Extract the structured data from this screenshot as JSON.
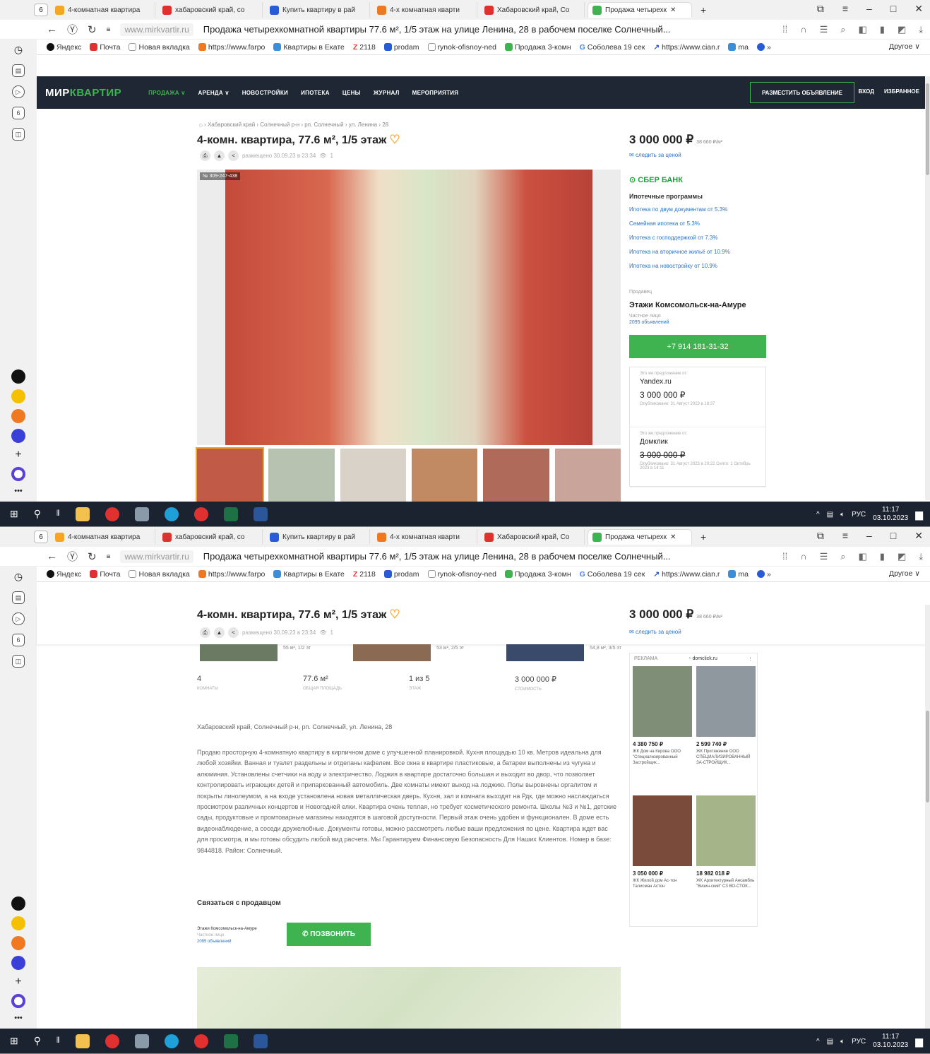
{
  "browser": {
    "tab_count": "6",
    "tabs": [
      {
        "label": "4-комнатная квартира",
        "color": "#f5a623"
      },
      {
        "label": "хабаровский край, со",
        "color": "#e03030"
      },
      {
        "label": "Купить квартиру в рай",
        "color": "#2a5bd7"
      },
      {
        "label": "4-х комнатная кварти",
        "color": "#f07820"
      },
      {
        "label": "Хабаровский край, Со",
        "color": "#e03030"
      },
      {
        "label": "Продажа четырехк",
        "color": "#3eb34f",
        "active": true
      }
    ],
    "new_tab": "+",
    "url": "www.mirkvartir.ru",
    "page_title": "Продажа четырехкомнатной квартиры 77.6 м², 1/5 этаж на улице Ленина, 28 в рабочем поселке Солнечный...",
    "bookmarks": [
      {
        "label": "Яндекс",
        "color": "#111"
      },
      {
        "label": "Почта",
        "color": "#e03030"
      },
      {
        "label": "Новая вкладка",
        "color": "#bbb"
      },
      {
        "label": "https://www.farpo",
        "color": "#f07820"
      },
      {
        "label": "Квартиры в Екате",
        "color": "#3a8fd8"
      },
      {
        "label": "2118",
        "color": "#e03030"
      },
      {
        "label": "prodam",
        "color": "#2a5bd7"
      },
      {
        "label": "rynok-ofisnoy-ned",
        "color": "#bbb"
      },
      {
        "label": "Продажа 3-комн",
        "color": "#3eb34f"
      },
      {
        "label": "Соболева 19 сек",
        "color": "#4285f4"
      },
      {
        "label": "https://www.cian.r",
        "color": "#2a5bd7"
      },
      {
        "label": "ma",
        "color": "#3a8fd8"
      },
      {
        "label": "»",
        "color": "#fff"
      }
    ],
    "bookmarks_other": "Другое ∨"
  },
  "taskbar": {
    "lang": "РУС",
    "time": "11:17",
    "date": "03.10.2023"
  },
  "site": {
    "logo_a": "МИР",
    "logo_b": "КВАРТИР",
    "menu": [
      "ПРОДАЖА ∨",
      "АРЕНДА ∨",
      "НОВОСТРОЙКИ",
      "ИПОТЕКА",
      "ЦЕНЫ",
      "ЖУРНАЛ",
      "МЕРОПРИЯТИЯ"
    ],
    "post_ad": "РАЗМЕСТИТЬ ОБЪЯВЛЕНИЕ",
    "login": "ВХОД",
    "favorites": "ИЗБРАННОЕ"
  },
  "listing": {
    "breadcrumbs": "⌂ › Хабаровский край › Солнечный р-н › рп. Солнечный › ул. Ленина › 28",
    "title": "4-комн. квартира, 77.6 м², 1/5 этаж",
    "posted": "размещено 30.09.23 в 23:34",
    "views": "1",
    "photo_id": "№ 309-247-438",
    "price": "3 000 000 ₽",
    "price_per_m2": "38 660 ₽/м²",
    "follow_price": "следить за ценой",
    "bank": "СБЕР БАНК",
    "mortgage_title": "Ипотечные программы",
    "mortgage": [
      "Ипотека по двум документам от 5.3%",
      "Семейная ипотека от 5.3%",
      "Ипотека с господдержкой от 7.3%",
      "Ипотека на вторичное жильё от 10.9%",
      "Ипотека на новостройку от 10.9%"
    ],
    "seller_caption": "Продавец",
    "seller_name": "Этажи Комсомольск-на-Амуре",
    "seller_type": "Частное лицо",
    "seller_ads": "2095 объявлений",
    "phone": "+7 914 181-31-32",
    "other_sites": [
      {
        "caption": "Это же предложение от:",
        "source": "Yandex.ru",
        "price": "3 000 000 ₽",
        "date": "Опубликовано: 31 Август 2023 в 18:37",
        "strike": false
      },
      {
        "caption": "Это же предложение от:",
        "source": "Домклик",
        "price": "3 000 000 ₽",
        "date": "Опубликовано: 31 Август 2023 в 20:22   Снято: 1 Октябрь 2023 в 14:11",
        "strike": true
      }
    ],
    "stats": [
      {
        "value": "4",
        "label": "комнаты"
      },
      {
        "value": "77.6 м²",
        "label": "общая площадь"
      },
      {
        "value": "1 из 5",
        "label": "этаж"
      },
      {
        "value": "3 000 000 ₽",
        "label": "стоимость"
      }
    ],
    "similar_captions": [
      "55 м², 1/2 эт",
      "53 м², 2/5 эт",
      "54,8 м², 3/5 эт"
    ],
    "address": "Хабаровский край, Солнечный р-н, рп. Солнечный, ул. Ленина, 28",
    "description": "Продаю просторную 4-комнатную квартиру в кирпичном доме с улучшенной планировкой. Кухня площадью 10 кв. Метров идеальна для любой хозяйки. Ванная и туалет раздельны и отделаны кафелем. Все окна в квартире пластиковые, а батареи выполнены из чугуна и алюминия. Установлены счетчики на воду и электричество. Лоджия в квартире достаточно большая и выходит во двор, что позволяет контролировать играющих детей и припаркованный автомобиль. Две комнаты имеют выход на лоджию. Полы выровнены оргалитом и покрыты линолеумом, а на входе установлена новая металлическая дверь. Кухня, зал и комната выходят на Рдк, где можно наслаждаться просмотром различных концертов и Новогодней елки. Квартира очень теплая, но требует косметического ремонта. Школы №3 и №1, детские сады, продуктовые и промтоварные магазины находятся в шаговой доступности. Первый этаж очень удобен и функционален. В доме есть видеонаблюдение, а соседи дружелюбные. Документы готовы, можно рассмотреть любые ваши предложения по цене. Квартира ждет вас для просмотра, и мы готовы обсудить любой вид расчета. Мы Гарантируем Финансовую Безопасность Для Наших Клиентов. Номер в базе: 9844818. Район: Солнечный.",
    "contact_heading": "Связаться с продавцом",
    "call_button": "✆ ПОЗВОНИТЬ"
  },
  "ad": {
    "label": "РЕКЛАМА",
    "brand": "domclick.ru",
    "cards": [
      {
        "price": "4 380 750 ₽",
        "caption": "ЖК Дом на Кирова ООО \"Специализированный Застройщик...",
        "color": "#7f8f77"
      },
      {
        "price": "2 599 740 ₽",
        "caption": "ЖК Притяжение ООО СПЕЦИАЛИЗИРОВАННЫЙ ЗА-СТРОЙЩИК...",
        "color": "#8f989f"
      },
      {
        "price": "3 050 000 ₽",
        "caption": "ЖК Жилой дом Ас-тон Талисман Астон",
        "color": "#7a4b3a"
      },
      {
        "price": "18 982 018 ₽",
        "caption": "ЖК Архитектурный Ансамбль \"Визин-ский\" СЗ ВО-СТОК...",
        "color": "#a6b48a"
      }
    ]
  }
}
